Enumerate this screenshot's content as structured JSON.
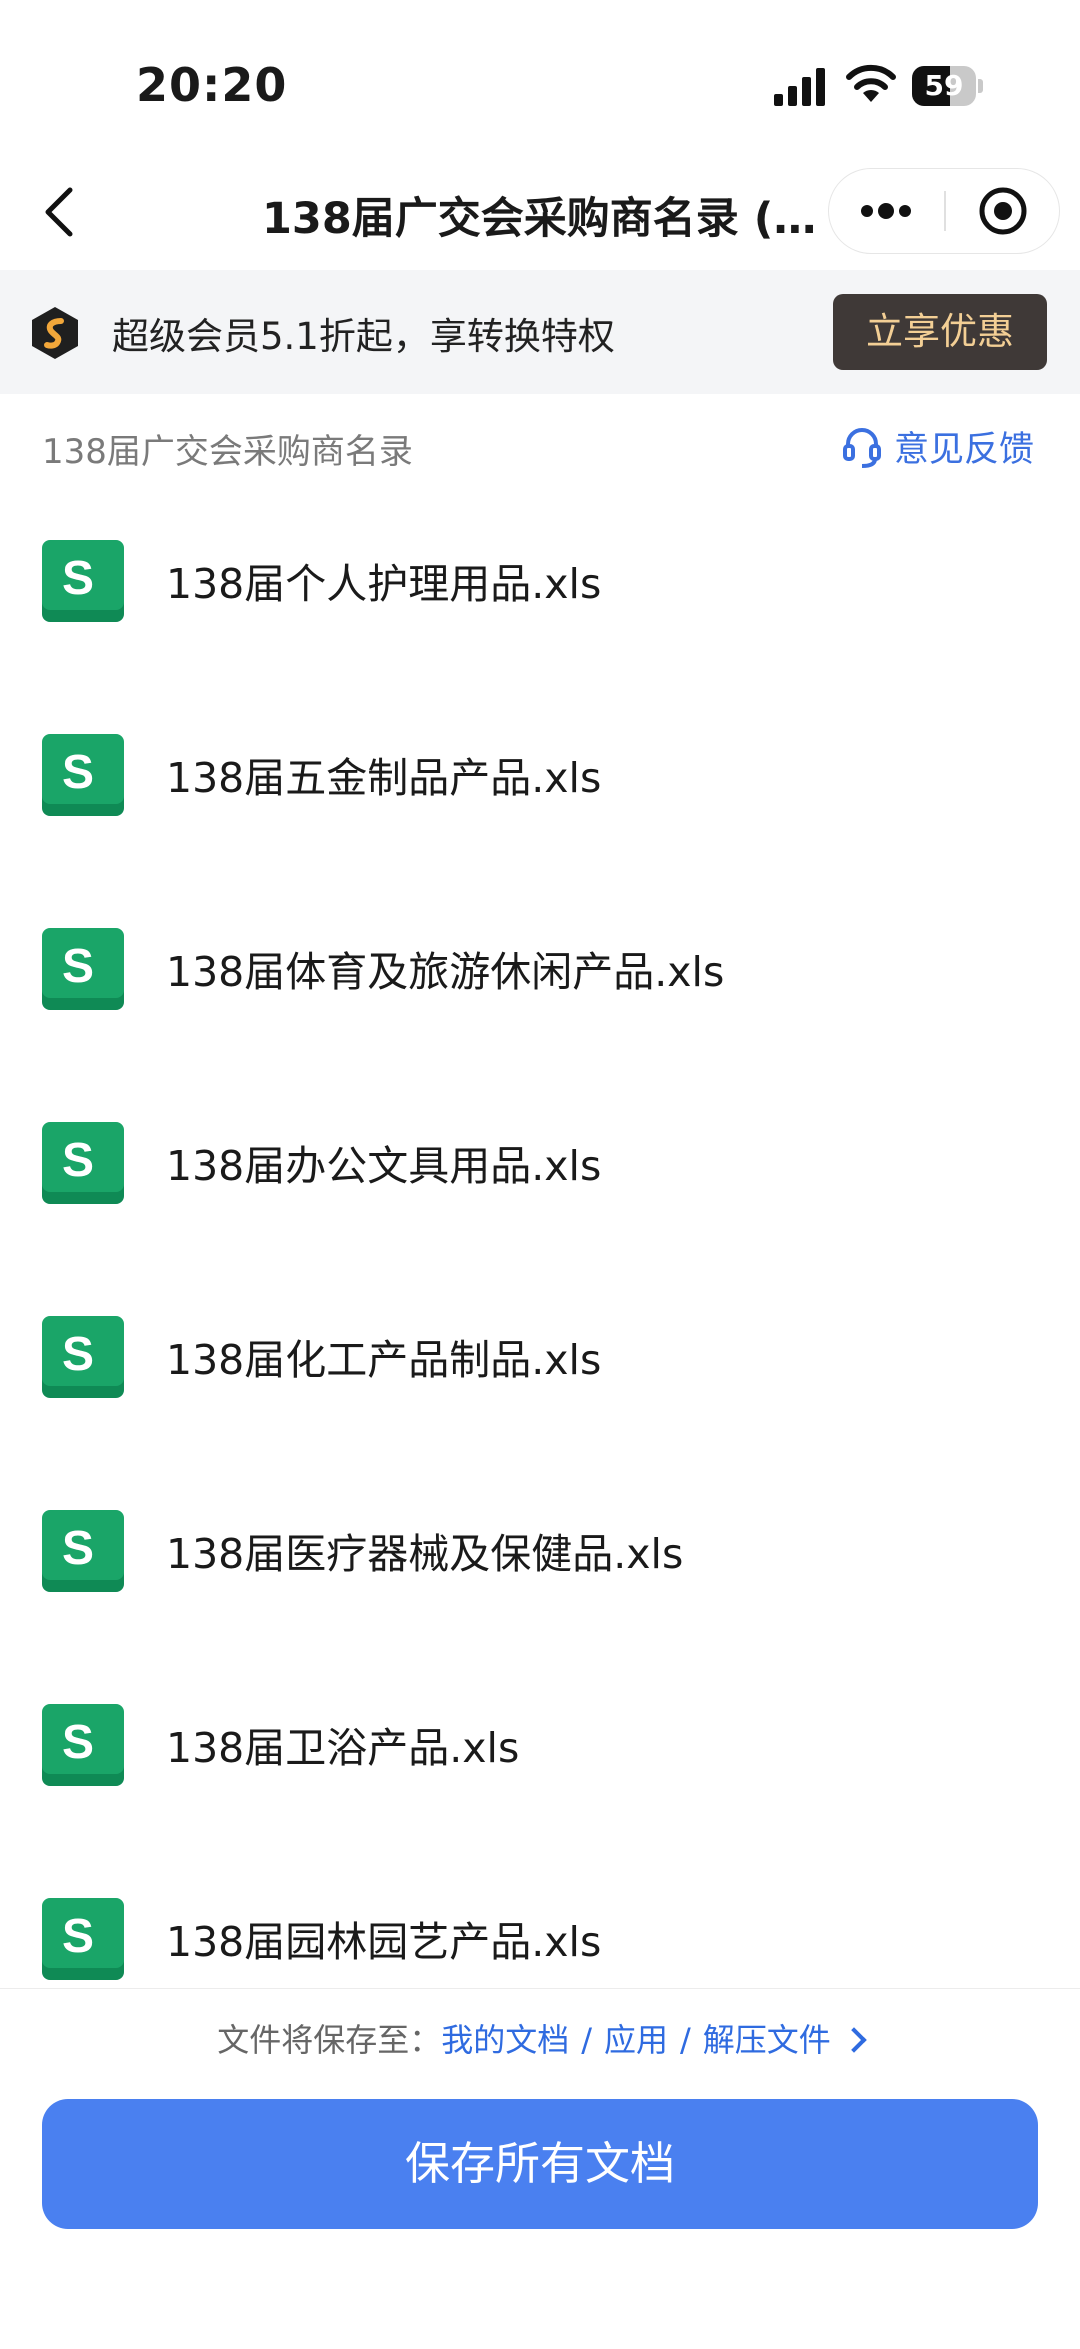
{
  "status_bar": {
    "time": "20:20",
    "battery": "59",
    "battery_level": 0.59
  },
  "nav": {
    "title": "138届广交会采购商名录 (1…"
  },
  "promo": {
    "text": "超级会员5.1折起，享转换特权",
    "button_label": "立享优惠"
  },
  "section": {
    "title": "138届广交会采购商名录",
    "feedback_label": "意见反馈"
  },
  "files": [
    {
      "icon_letter": "S",
      "name": "138届个人护理用品.xls"
    },
    {
      "icon_letter": "S",
      "name": "138届五金制品产品.xls"
    },
    {
      "icon_letter": "S",
      "name": "138届体育及旅游休闲产品.xls"
    },
    {
      "icon_letter": "S",
      "name": "138届办公文具用品.xls"
    },
    {
      "icon_letter": "S",
      "name": "138届化工产品制品.xls"
    },
    {
      "icon_letter": "S",
      "name": "138届医疗器械及保健品.xls"
    },
    {
      "icon_letter": "S",
      "name": "138届卫浴产品.xls"
    },
    {
      "icon_letter": "S",
      "name": "138届园林园艺产品.xls"
    }
  ],
  "bottom": {
    "save_path_label": "文件将保存至：",
    "path": [
      "我的文档",
      "应用",
      "解压文件"
    ],
    "path_separator": "/",
    "save_button_label": "保存所有文档"
  },
  "colors": {
    "accent": "#4a80f0",
    "link": "#2f6be0",
    "sheet_icon": "#1aa568",
    "promo_button_bg": "#3f3937",
    "promo_button_text": "#f3cf95"
  },
  "icons": {
    "back": "chevron-left-icon",
    "more": "more-dots-icon",
    "close": "target-circle-icon",
    "promo": "vip-hexagon-icon",
    "feedback": "headset-icon",
    "file": "spreadsheet-icon"
  }
}
